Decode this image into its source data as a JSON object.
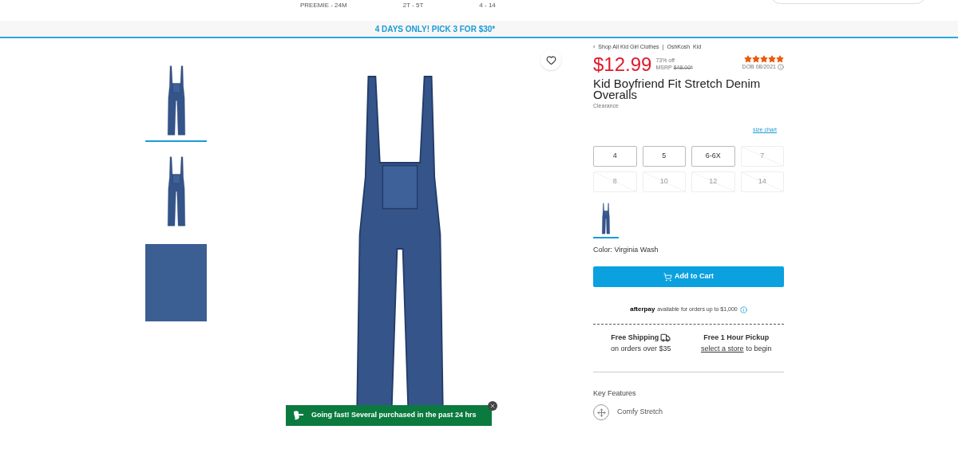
{
  "size_ranges": [
    "PREEMIE - 24M",
    "2T - 5T",
    "4 - 14"
  ],
  "promo_banner": "4 DAYS ONLY! PICK 3 FOR $30*",
  "thumbnails": [
    {
      "kind": "front",
      "selected": true
    },
    {
      "kind": "back",
      "selected": false
    },
    {
      "kind": "fabric",
      "selected": false
    }
  ],
  "breadcrumb": {
    "arrow": "‹",
    "items": [
      "Shop All Kid Girl Clothes",
      "OshKosh  Kid"
    ],
    "separator": "|"
  },
  "price": "$12.99",
  "discount": "73% off",
  "msrp_label": "MSRP",
  "msrp": "$48.00*",
  "rating": {
    "stars": 5
  },
  "dob": "DOB 08/2021",
  "title": "Kid Boyfriend Fit Stretch Denim Overalls",
  "tag": "Clearance",
  "size_chart": "size chart",
  "sizes": [
    {
      "label": "4",
      "available": true
    },
    {
      "label": "5",
      "available": true
    },
    {
      "label": "6-6X",
      "available": true
    },
    {
      "label": "7",
      "available": false
    },
    {
      "label": "8",
      "available": false
    },
    {
      "label": "10",
      "available": false
    },
    {
      "label": "12",
      "available": false
    },
    {
      "label": "14",
      "available": false
    }
  ],
  "swatches": [
    {
      "selected": true
    }
  ],
  "color_label": "Color: Virginia Wash",
  "add_to_cart": "Add to Cart",
  "afterpay": {
    "logo": "afterpay",
    "text": "available for orders up to $1,000"
  },
  "shipping": {
    "title": "Free Shipping",
    "subtitle": "on orders over $35"
  },
  "pickup": {
    "title": "Free 1 Hour Pickup",
    "link": "select a store",
    "suffix": "to begin"
  },
  "key_features": {
    "heading": "Key Features",
    "items": [
      "Comfy Stretch"
    ]
  },
  "toast": "Going fast! Several purchased in the past 24 hrs"
}
